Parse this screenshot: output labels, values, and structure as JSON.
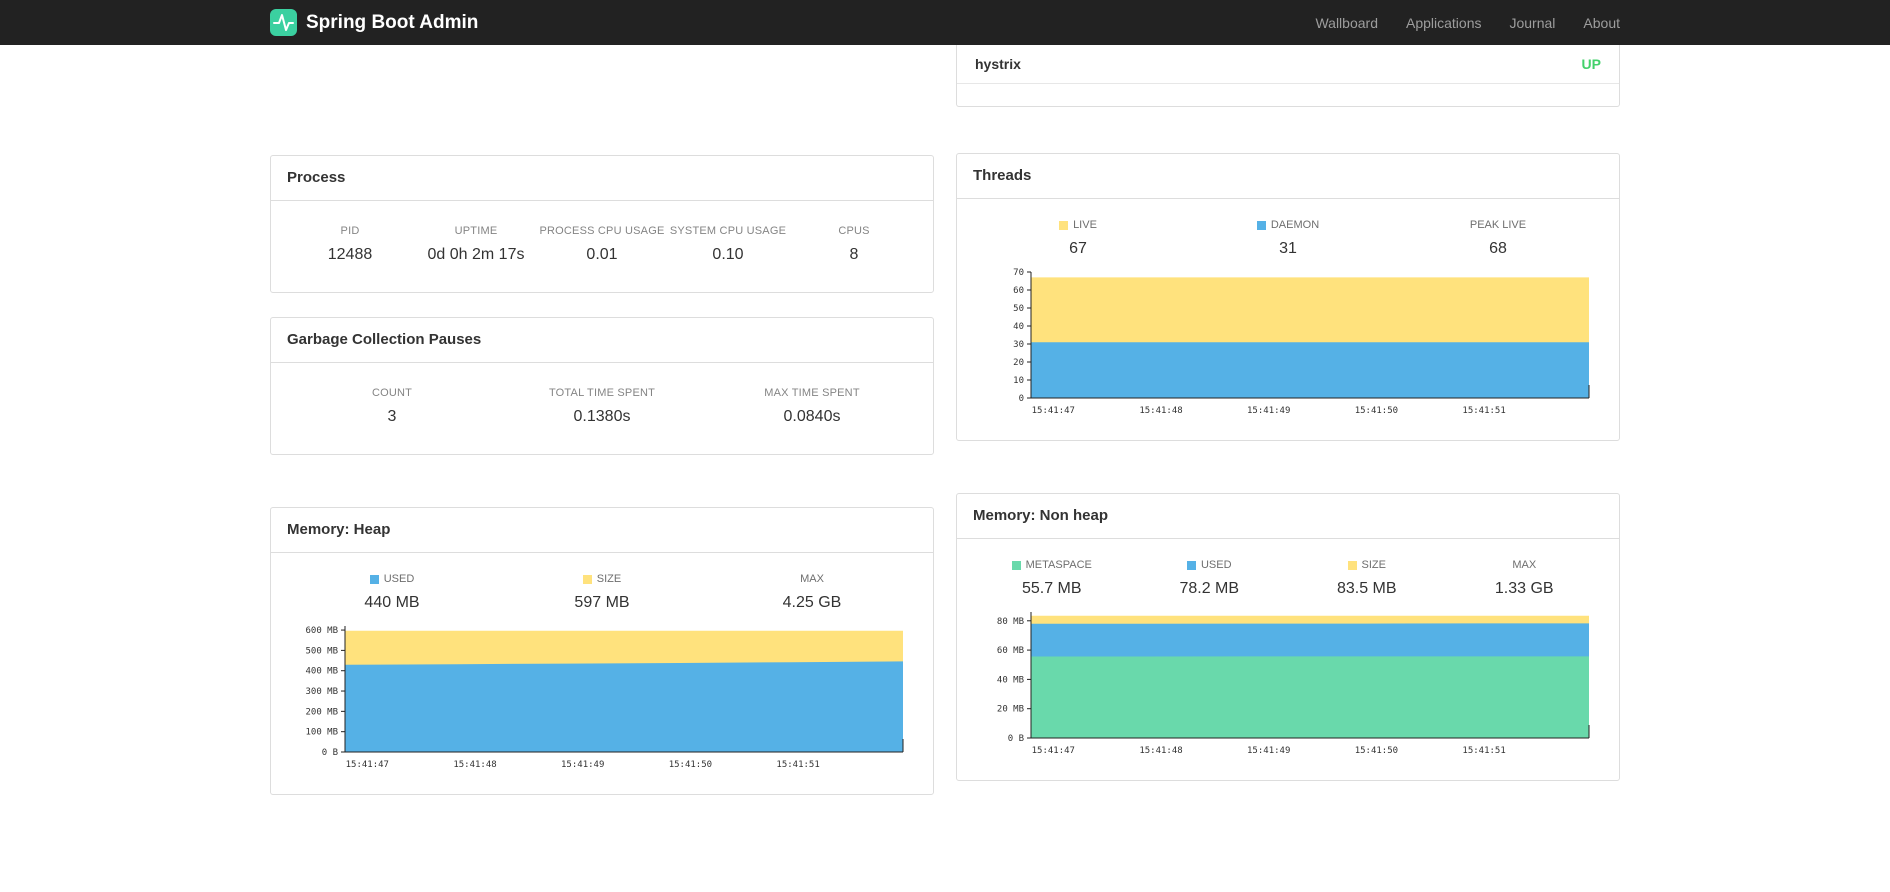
{
  "navbar": {
    "brand": "Spring Boot Admin",
    "items": [
      {
        "label": "Wallboard"
      },
      {
        "label": "Applications"
      },
      {
        "label": "Journal"
      },
      {
        "label": "About"
      }
    ]
  },
  "colors": {
    "brand_green": "#3BD0A0",
    "status_up": "#43D16B",
    "series_yellow": "#FFE27D",
    "series_blue": "#55B1E6",
    "series_green": "#69D9AB"
  },
  "application_panel": {
    "rows": [
      {
        "name": "hystrix",
        "status": "UP"
      }
    ]
  },
  "process": {
    "title": "Process",
    "stats": [
      {
        "label": "PID",
        "value": "12488"
      },
      {
        "label": "UPTIME",
        "value": "0d 0h 2m 17s"
      },
      {
        "label": "PROCESS CPU USAGE",
        "value": "0.01"
      },
      {
        "label": "SYSTEM CPU USAGE",
        "value": "0.10"
      },
      {
        "label": "CPUS",
        "value": "8"
      }
    ]
  },
  "gc": {
    "title": "Garbage Collection Pauses",
    "stats": [
      {
        "label": "COUNT",
        "value": "3"
      },
      {
        "label": "TOTAL TIME SPENT",
        "value": "0.1380s"
      },
      {
        "label": "MAX TIME SPENT",
        "value": "0.0840s"
      }
    ]
  },
  "threads": {
    "title": "Threads",
    "legends": [
      {
        "label": "LIVE",
        "value": "67",
        "color": "#FFE27D"
      },
      {
        "label": "DAEMON",
        "value": "31",
        "color": "#55B1E6"
      },
      {
        "label": "PEAK LIVE",
        "value": "68",
        "color": null
      }
    ]
  },
  "memory_heap": {
    "title": "Memory: Heap",
    "legends": [
      {
        "label": "USED",
        "value": "440 MB",
        "color": "#55B1E6"
      },
      {
        "label": "SIZE",
        "value": "597 MB",
        "color": "#FFE27D"
      },
      {
        "label": "MAX",
        "value": "4.25 GB",
        "color": null
      }
    ]
  },
  "memory_nonheap": {
    "title": "Memory: Non heap",
    "legends": [
      {
        "label": "METASPACE",
        "value": "55.7 MB",
        "color": "#69D9AB"
      },
      {
        "label": "USED",
        "value": "78.2 MB",
        "color": "#55B1E6"
      },
      {
        "label": "SIZE",
        "value": "83.5 MB",
        "color": "#FFE27D"
      },
      {
        "label": "MAX",
        "value": "1.33 GB",
        "color": null
      }
    ]
  },
  "chart_data": [
    {
      "type": "area",
      "title": "Threads over time",
      "x": [
        "15:41:47",
        "15:41:48",
        "15:41:49",
        "15:41:50",
        "15:41:51"
      ],
      "ymax": 70,
      "yticks": [
        {
          "v": 0,
          "label": "0"
        },
        {
          "v": 10,
          "label": "10"
        },
        {
          "v": 20,
          "label": "20"
        },
        {
          "v": 30,
          "label": "30"
        },
        {
          "v": 40,
          "label": "40"
        },
        {
          "v": 50,
          "label": "50"
        },
        {
          "v": 60,
          "label": "60"
        },
        {
          "v": 70,
          "label": "70"
        }
      ],
      "series": [
        {
          "name": "LIVE",
          "color": "#FFE27D",
          "values": [
            67,
            67,
            67,
            67,
            67,
            67
          ]
        },
        {
          "name": "DAEMON",
          "color": "#55B1E6",
          "values": [
            31,
            31,
            31,
            31,
            31,
            31
          ]
        }
      ]
    },
    {
      "type": "area",
      "title": "Memory: Heap over time (MB)",
      "x": [
        "15:41:47",
        "15:41:48",
        "15:41:49",
        "15:41:50",
        "15:41:51"
      ],
      "ymax": 620,
      "yticks": [
        {
          "v": 0,
          "label": "0 B"
        },
        {
          "v": 100,
          "label": "100 MB"
        },
        {
          "v": 200,
          "label": "200 MB"
        },
        {
          "v": 300,
          "label": "300 MB"
        },
        {
          "v": 400,
          "label": "400 MB"
        },
        {
          "v": 500,
          "label": "500 MB"
        },
        {
          "v": 600,
          "label": "600 MB"
        }
      ],
      "series": [
        {
          "name": "SIZE",
          "color": "#FFE27D",
          "values": [
            597,
            597,
            597,
            597,
            597,
            597
          ]
        },
        {
          "name": "USED",
          "color": "#55B1E6",
          "values": [
            429,
            432,
            435,
            438,
            442,
            446
          ]
        }
      ]
    },
    {
      "type": "area",
      "title": "Memory: Non heap over time (MB)",
      "x": [
        "15:41:47",
        "15:41:48",
        "15:41:49",
        "15:41:50",
        "15:41:51"
      ],
      "ymax": 86,
      "yticks": [
        {
          "v": 0,
          "label": "0 B"
        },
        {
          "v": 20,
          "label": "20 MB"
        },
        {
          "v": 40,
          "label": "40 MB"
        },
        {
          "v": 60,
          "label": "60 MB"
        },
        {
          "v": 80,
          "label": "80 MB"
        }
      ],
      "series": [
        {
          "name": "SIZE",
          "color": "#FFE27D",
          "values": [
            83.5,
            83.5,
            83.5,
            83.5,
            83.5,
            83.5
          ]
        },
        {
          "name": "USED",
          "color": "#55B1E6",
          "values": [
            78.0,
            78.0,
            78.1,
            78.1,
            78.2,
            78.2
          ]
        },
        {
          "name": "METASPACE",
          "color": "#69D9AB",
          "values": [
            55.6,
            55.6,
            55.7,
            55.7,
            55.7,
            55.7
          ]
        }
      ]
    }
  ]
}
